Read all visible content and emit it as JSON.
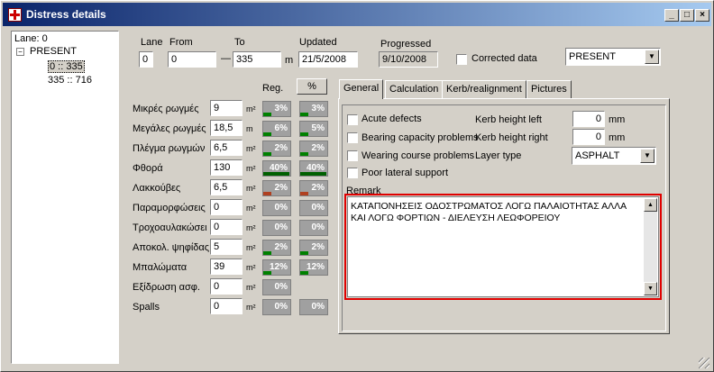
{
  "window": {
    "title": "Distress details"
  },
  "tree": {
    "root": "Lane: 0",
    "present": "PRESENT",
    "items": [
      "0 :: 335",
      "335 :: 716"
    ]
  },
  "header": {
    "lane_label": "Lane",
    "lane": "0",
    "from_label": "From",
    "from": "0",
    "to_label": "To",
    "to": "335",
    "to_unit": "m",
    "updated_label": "Updated",
    "updated": "21/5/2008",
    "progressed_label": "Progressed",
    "progressed": "9/10/2008",
    "corrected_label": "Corrected data",
    "scenario": "PRESENT",
    "dash": "—"
  },
  "distress": {
    "reg_label": "Reg.",
    "pct_button": "%",
    "rows": [
      {
        "label": "Μικρές ρωγμές",
        "value": "9",
        "unit": "m²",
        "reg": "3%",
        "pct": "3%",
        "reg_frac": 0.03,
        "pct_frac": 0.03,
        "color": "#008000",
        "has_pct": true
      },
      {
        "label": "Μεγάλες ρωγμές",
        "value": "18,5",
        "unit": "m",
        "reg": "6%",
        "pct": "5%",
        "reg_frac": 0.06,
        "pct_frac": 0.05,
        "color": "#008000",
        "has_pct": true
      },
      {
        "label": "Πλέγμα ρωγμών",
        "value": "6,5",
        "unit": "m²",
        "reg": "2%",
        "pct": "2%",
        "reg_frac": 0.02,
        "pct_frac": 0.02,
        "color": "#008000",
        "has_pct": true
      },
      {
        "label": "Φθορά",
        "value": "130",
        "unit": "m²",
        "reg": "40%",
        "pct": "40%",
        "reg_frac": 0.4,
        "pct_frac": 0.4,
        "color": "#006000",
        "has_pct": true
      },
      {
        "label": "Λακκούβες",
        "value": "6,5",
        "unit": "m²",
        "reg": "2%",
        "pct": "2%",
        "reg_frac": 0.02,
        "pct_frac": 0.02,
        "color": "#b04020",
        "has_pct": true
      },
      {
        "label": "Παραμορφώσεις",
        "value": "0",
        "unit": "m²",
        "reg": "0%",
        "pct": "0%",
        "reg_frac": 0,
        "pct_frac": 0,
        "color": "#808080",
        "has_pct": true
      },
      {
        "label": "Τροχοαυλακώσει",
        "value": "0",
        "unit": "m²",
        "reg": "0%",
        "pct": "0%",
        "reg_frac": 0,
        "pct_frac": 0,
        "color": "#808080",
        "has_pct": true
      },
      {
        "label": "Αποκολ. ψηφίδας",
        "value": "5",
        "unit": "m²",
        "reg": "2%",
        "pct": "2%",
        "reg_frac": 0.02,
        "pct_frac": 0.02,
        "color": "#008000",
        "has_pct": true
      },
      {
        "label": "Μπαλώματα",
        "value": "39",
        "unit": "m²",
        "reg": "12%",
        "pct": "12%",
        "reg_frac": 0.12,
        "pct_frac": 0.12,
        "color": "#008000",
        "has_pct": true
      },
      {
        "label": "Εξίδρωση ασφ.",
        "value": "0",
        "unit": "m²",
        "reg": "0%",
        "pct": "",
        "reg_frac": 0,
        "pct_frac": 0,
        "color": "#808080",
        "has_pct": false
      },
      {
        "label": "Spalls",
        "value": "0",
        "unit": "m²",
        "reg": "0%",
        "pct": "0%",
        "reg_frac": 0,
        "pct_frac": 0,
        "color": "#808080",
        "has_pct": true
      }
    ]
  },
  "tabs": [
    "General",
    "Calculation",
    "Kerb/realignment",
    "Pictures"
  ],
  "general": {
    "acute": "Acute defects",
    "bearing": "Bearing capacity problems",
    "wearing": "Wearing course problems",
    "poor": "Poor lateral support",
    "kerb_left_label": "Kerb height left",
    "kerb_left": "0",
    "kerb_left_unit": "mm",
    "kerb_right_label": "Kerb height right",
    "kerb_right": "0",
    "kerb_right_unit": "mm",
    "layer_label": "Layer type",
    "layer": "ASPHALT",
    "remark_label": "Remark",
    "remark": "ΚΑΤΑΠΟΝΗΣΕΙΣ ΟΔΟΣΤΡΩΜΑΤΟΣ ΛΟΓΩ ΠΑΛΑΙΟΤΗΤΑΣ ΑΛΛΑ ΚΑΙ ΛΟΓΩ ΦΟΡΤΙΩΝ - ΔΙΕΛΕΥΣΗ ΛΕΩΦΟΡΕΙΟΥ"
  }
}
